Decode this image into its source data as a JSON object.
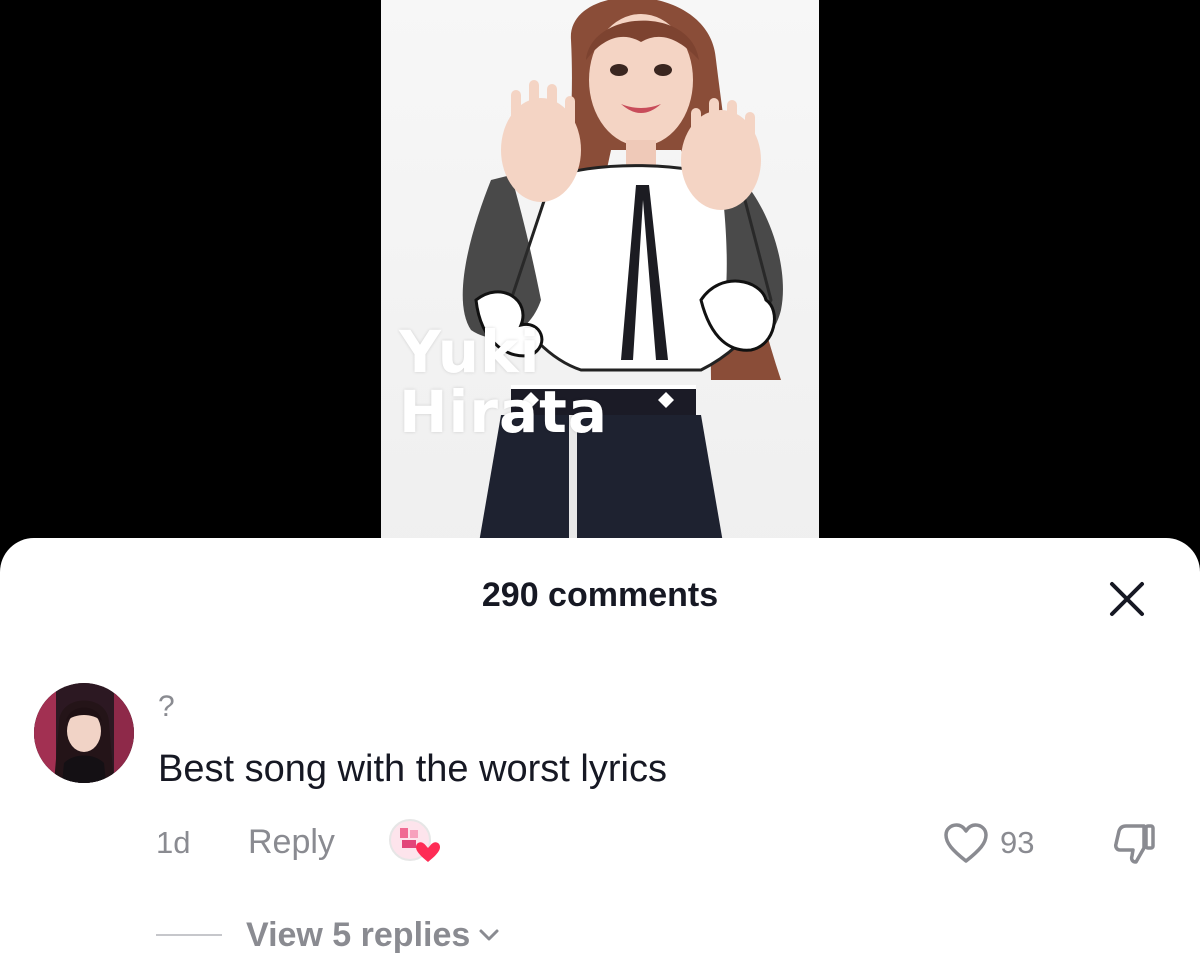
{
  "video": {
    "overlay_line1": "Yuki",
    "overlay_line2": "Hirata"
  },
  "comments_panel": {
    "title": "290 comments",
    "close_icon": "close-icon"
  },
  "comment": {
    "username": "?",
    "text": "Best song with the worst lyrics",
    "time": "1d",
    "reply_label": "Reply",
    "like_count": "93",
    "view_replies_label": "View 5 replies"
  },
  "colors": {
    "text_primary": "#161823",
    "text_secondary": "#8a8b91",
    "creator_heart": "#fe2c55"
  }
}
